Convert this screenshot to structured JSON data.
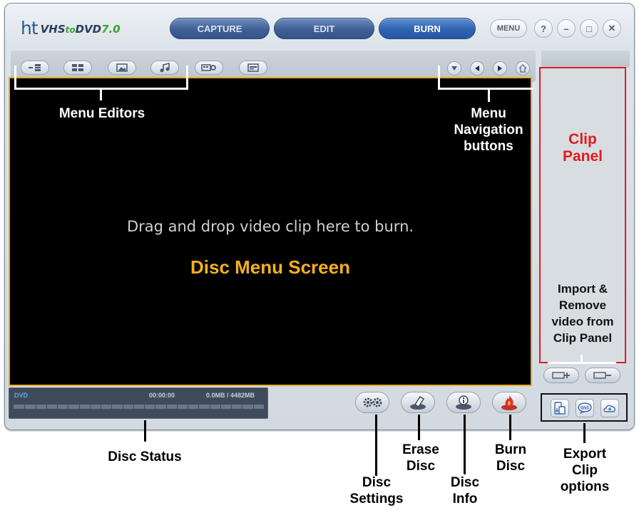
{
  "app": {
    "logo": {
      "mark": "ht",
      "prefix": "VHS",
      "to": "to",
      "product": "DVD",
      "version": "7.0"
    }
  },
  "mode_tabs": [
    {
      "label": "CAPTURE",
      "active": false
    },
    {
      "label": "EDIT",
      "active": false
    },
    {
      "label": "BURN",
      "active": true
    }
  ],
  "window_buttons": {
    "menu": "MENU",
    "help": "?",
    "minimize": "–",
    "maximize": "□",
    "close": "✕"
  },
  "toolbar": {
    "menu_editor_icons": [
      "menu-layout-icon",
      "menu-template-icon",
      "background-image-icon",
      "background-music-icon",
      "menu-settings-icon",
      "menu-text-icon"
    ],
    "nav_icons": [
      "down-triangle-icon",
      "previous-icon",
      "next-icon",
      "home-icon"
    ]
  },
  "screen": {
    "drop_hint": "Drag and drop video clip here to burn.",
    "title": "Disc Menu Screen"
  },
  "status": {
    "disc_type": "DVD",
    "duration": "00:00:00",
    "size": "0.0MB / 4482MB",
    "usage_fraction": 0.0
  },
  "actions": [
    {
      "name": "disc-settings",
      "icon": "gears-icon"
    },
    {
      "name": "erase-disc",
      "icon": "eraser-icon"
    },
    {
      "name": "disc-info",
      "icon": "info-icon"
    },
    {
      "name": "burn-disc",
      "icon": "flame-icon"
    }
  ],
  "clip_panel": {
    "title": [
      "Clip",
      "Panel"
    ],
    "import_label": [
      "Import &",
      "Remove",
      "video from",
      "Clip Panel"
    ]
  },
  "export_icons": [
    "export-to-device-icon",
    "sns-share-icon",
    "cloud-upload-icon"
  ],
  "annotations": {
    "menu_editors": "Menu Editors",
    "menu_navigation": [
      "Menu",
      "Navigation",
      "buttons"
    ],
    "disc_status": "Disc Status",
    "disc_settings": [
      "Disc",
      "Settings"
    ],
    "erase_disc": [
      "Erase",
      "Disc"
    ],
    "disc_info": [
      "Disc",
      "Info"
    ],
    "burn_disc": [
      "Burn",
      "Disc"
    ],
    "export_clip_options": [
      "Export",
      "Clip",
      "options"
    ]
  },
  "colors": {
    "screen_border": "#e9ae1e",
    "screen_title": "#f5b01c",
    "clip_panel_highlight": "#e21b1b",
    "active_tab": "#2f63b3",
    "burn_icon": "#e0342a"
  }
}
